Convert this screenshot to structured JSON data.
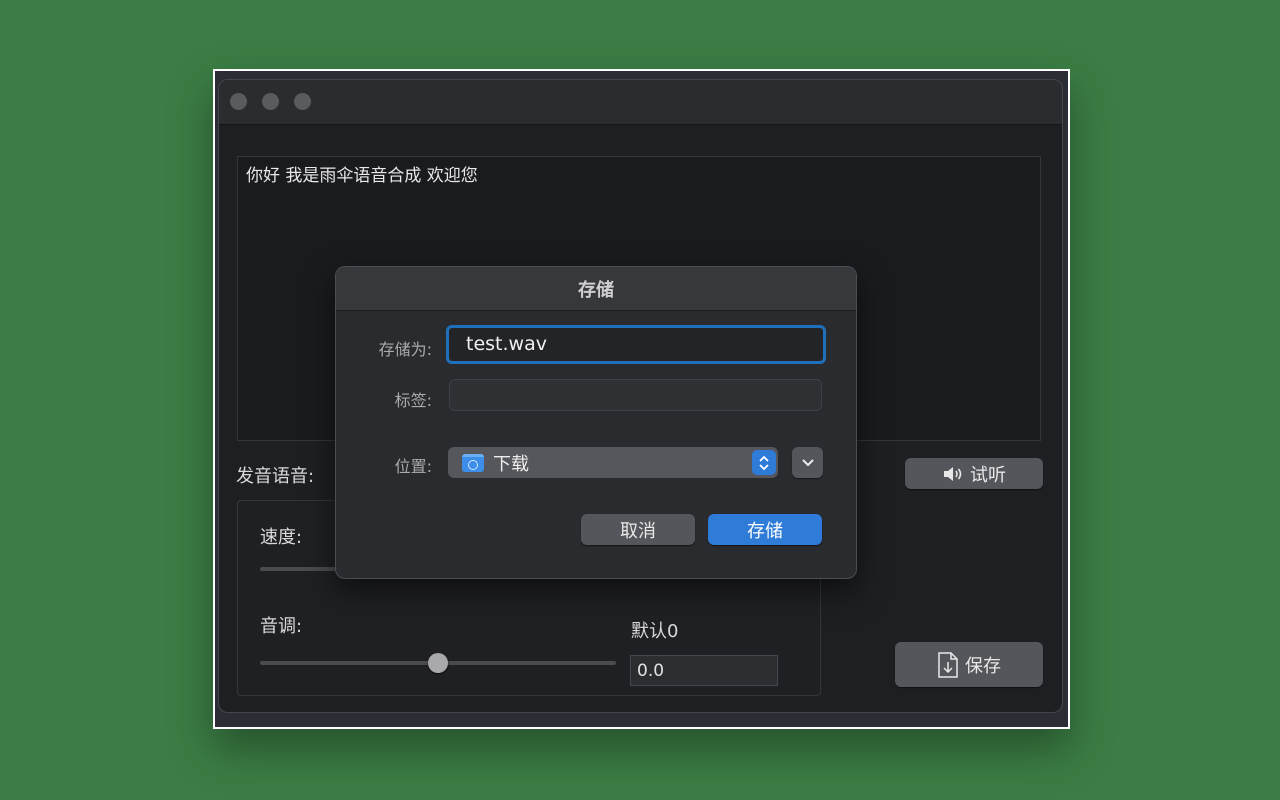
{
  "editor": {
    "text": "你好 我是雨伞语音合成 欢迎您"
  },
  "labels": {
    "voice": "发音语音:",
    "speed": "速度:",
    "pitch": "音调:",
    "pitch_default": "默认0",
    "pitch_value": "0.0"
  },
  "pitch_slider_value_fraction": 0.5,
  "buttons": {
    "preview": "试听",
    "save": "保存"
  },
  "dialog": {
    "title": "存储",
    "save_as_label": "存储为:",
    "save_as_value": "test.wav",
    "tags_label": "标签:",
    "tags_value": "",
    "location_label": "位置:",
    "location_value": "下载",
    "cancel": "取消",
    "save": "存储"
  },
  "colors": {
    "accent": "#2e7bd8",
    "focus_ring": "#1f6fba",
    "background": "#3b7d44"
  },
  "icons": {
    "speaker": "speaker-icon",
    "document_download": "document-download-icon",
    "folder": "downloads-folder-icon",
    "chevron_down": "chevron-down-icon",
    "stepper": "up-down-chevron-icon"
  }
}
